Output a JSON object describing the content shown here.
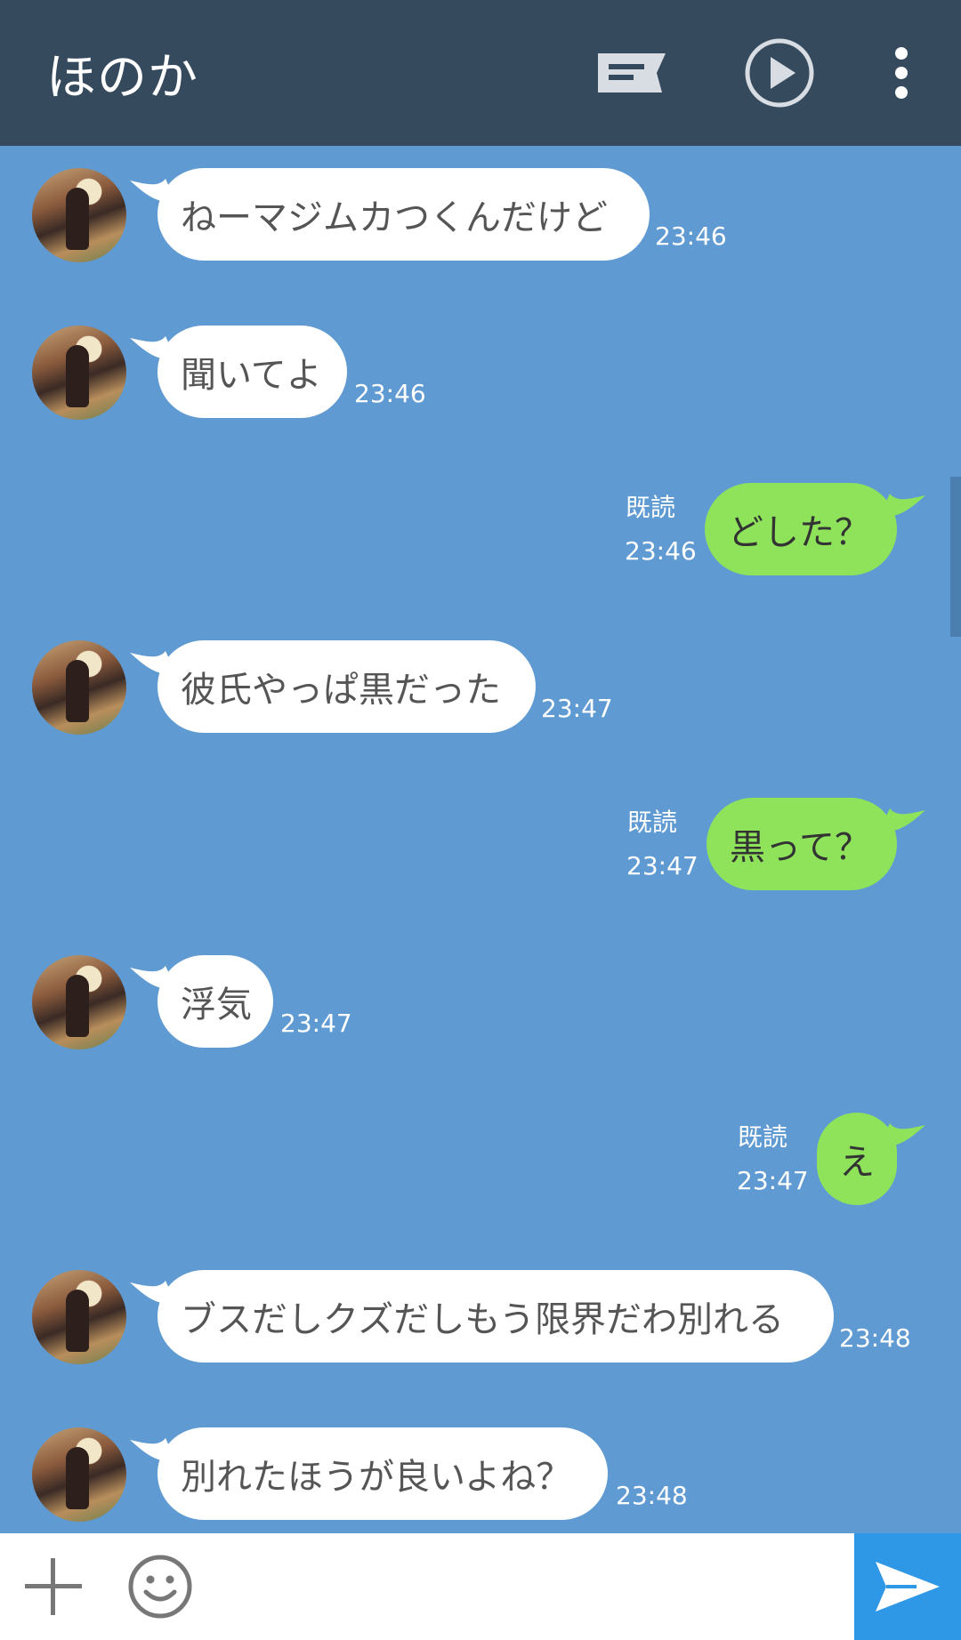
{
  "header": {
    "title": "ほのか",
    "note_icon": "note-icon",
    "play_icon": "play-circle-icon",
    "more_icon": "more-vertical-icon"
  },
  "messages": [
    {
      "side": "in",
      "text": "ねーマジムカつくんだけど",
      "time": "23:46"
    },
    {
      "side": "in",
      "text": "聞いてよ",
      "time": "23:46"
    },
    {
      "side": "out",
      "text": "どした？",
      "read": "既読",
      "time": "23:46"
    },
    {
      "side": "in",
      "text": "彼氏やっぱ黒だった",
      "time": "23:47"
    },
    {
      "side": "out",
      "text": "黒って？",
      "read": "既読",
      "time": "23:47"
    },
    {
      "side": "in",
      "text": "浮気",
      "time": "23:47"
    },
    {
      "side": "out",
      "text": "え",
      "read": "既読",
      "time": "23:47"
    },
    {
      "side": "in",
      "text": "ブスだしクズだしもう限界だわ別れる",
      "time": "23:48"
    },
    {
      "side": "in",
      "text": "別れたほうが良いよね？",
      "time": "23:48"
    }
  ],
  "footer": {
    "input_value": "",
    "plus_icon": "plus-icon",
    "emoji_icon": "smiley-icon",
    "send_icon": "send-icon"
  },
  "colors": {
    "background": "#5f9bd2",
    "header": "#364a5e",
    "incoming_bubble": "#ffffff",
    "outgoing_bubble": "#8ee35b",
    "send_button": "#2e97e6"
  }
}
